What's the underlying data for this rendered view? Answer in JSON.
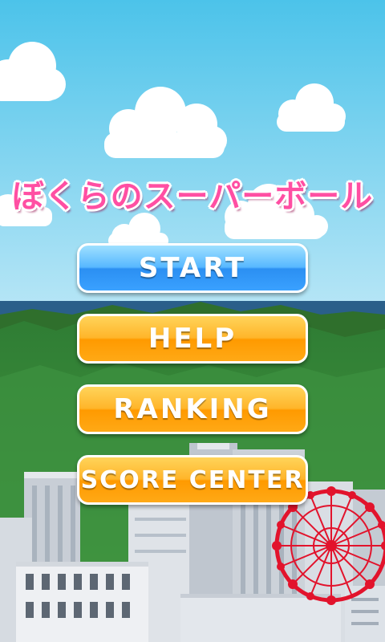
{
  "title": "ぼくらのスーパーボール",
  "menu": {
    "start": "START",
    "help": "HELP",
    "ranking": "RANKING",
    "score_center": "SCORE CENTER"
  },
  "colors": {
    "sky": "#8fd3f0",
    "sea": "#2a5f8a",
    "mountain": "#3c8f3a",
    "title": "#ff4fa3",
    "button_blue": "#3aa1ff",
    "button_orange": "#ffa916",
    "ferris_wheel": "#e2132c"
  }
}
